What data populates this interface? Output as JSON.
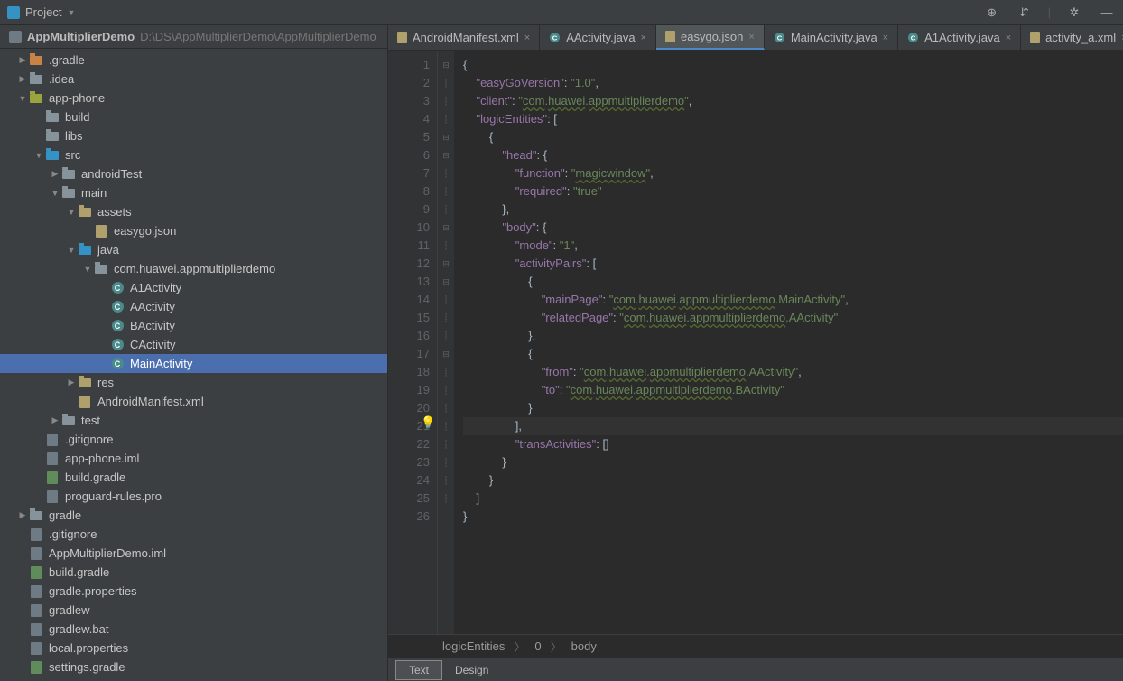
{
  "topbar": {
    "project_label": "Project"
  },
  "toolbar_icons": [
    "target",
    "vsplit",
    "sep",
    "gear",
    "minimize"
  ],
  "breadcrumb": {
    "name": "AppMultiplierDemo",
    "path": "D:\\DS\\AppMultiplierDemo\\AppMultiplierDemo"
  },
  "tree": [
    {
      "depth": 0,
      "arrow": "right",
      "icon": "folder orange",
      "label": ".gradle"
    },
    {
      "depth": 0,
      "arrow": "right",
      "icon": "folder",
      "label": ".idea"
    },
    {
      "depth": 0,
      "arrow": "down",
      "icon": "folder green",
      "label": "app-phone"
    },
    {
      "depth": 1,
      "arrow": "",
      "icon": "folder",
      "label": "build"
    },
    {
      "depth": 1,
      "arrow": "",
      "icon": "folder",
      "label": "libs"
    },
    {
      "depth": 1,
      "arrow": "down",
      "icon": "folder blue",
      "label": "src"
    },
    {
      "depth": 2,
      "arrow": "right",
      "icon": "folder",
      "label": "androidTest"
    },
    {
      "depth": 2,
      "arrow": "down",
      "icon": "folder",
      "label": "main"
    },
    {
      "depth": 3,
      "arrow": "down",
      "icon": "folder yellow",
      "label": "assets"
    },
    {
      "depth": 4,
      "arrow": "",
      "icon": "file json",
      "label": "easygo.json"
    },
    {
      "depth": 3,
      "arrow": "down",
      "icon": "folder blue",
      "label": "java"
    },
    {
      "depth": 4,
      "arrow": "down",
      "icon": "folder",
      "label": "com.huawei.appmultiplierdemo"
    },
    {
      "depth": 5,
      "arrow": "",
      "icon": "class",
      "label": "A1Activity"
    },
    {
      "depth": 5,
      "arrow": "",
      "icon": "class",
      "label": "AActivity"
    },
    {
      "depth": 5,
      "arrow": "",
      "icon": "class",
      "label": "BActivity"
    },
    {
      "depth": 5,
      "arrow": "",
      "icon": "class",
      "label": "CActivity"
    },
    {
      "depth": 5,
      "arrow": "",
      "icon": "class",
      "label": "MainActivity",
      "sel": true
    },
    {
      "depth": 3,
      "arrow": "right",
      "icon": "folder yellow",
      "label": "res"
    },
    {
      "depth": 3,
      "arrow": "",
      "icon": "file xml",
      "label": "AndroidManifest.xml"
    },
    {
      "depth": 2,
      "arrow": "right",
      "icon": "folder",
      "label": "test"
    },
    {
      "depth": 1,
      "arrow": "",
      "icon": "file",
      "label": ".gitignore"
    },
    {
      "depth": 1,
      "arrow": "",
      "icon": "file",
      "label": "app-phone.iml"
    },
    {
      "depth": 1,
      "arrow": "",
      "icon": "file gr",
      "label": "build.gradle"
    },
    {
      "depth": 1,
      "arrow": "",
      "icon": "file",
      "label": "proguard-rules.pro"
    },
    {
      "depth": 0,
      "arrow": "right",
      "icon": "folder",
      "label": "gradle"
    },
    {
      "depth": 0,
      "arrow": "",
      "icon": "file",
      "label": ".gitignore"
    },
    {
      "depth": 0,
      "arrow": "",
      "icon": "file",
      "label": "AppMultiplierDemo.iml"
    },
    {
      "depth": 0,
      "arrow": "",
      "icon": "file gr",
      "label": "build.gradle"
    },
    {
      "depth": 0,
      "arrow": "",
      "icon": "file",
      "label": "gradle.properties"
    },
    {
      "depth": 0,
      "arrow": "",
      "icon": "file",
      "label": "gradlew"
    },
    {
      "depth": 0,
      "arrow": "",
      "icon": "file",
      "label": "gradlew.bat"
    },
    {
      "depth": 0,
      "arrow": "",
      "icon": "file",
      "label": "local.properties"
    },
    {
      "depth": 0,
      "arrow": "",
      "icon": "file gr",
      "label": "settings.gradle"
    }
  ],
  "tabs": [
    {
      "icon": "xml",
      "label": "AndroidManifest.xml"
    },
    {
      "icon": "class",
      "label": "AActivity.java"
    },
    {
      "icon": "json",
      "label": "easygo.json",
      "active": true
    },
    {
      "icon": "class",
      "label": "MainActivity.java"
    },
    {
      "icon": "class",
      "label": "A1Activity.java"
    },
    {
      "icon": "xml",
      "label": "activity_a.xml"
    }
  ],
  "code": {
    "lines": 26,
    "content": "editor json source",
    "keys": {
      "easyGoVersion": "\"easyGoVersion\"",
      "v1": "\"1.0\"",
      "client": "\"client\"",
      "clientv": "\"com.huawei.appmultiplierdemo\"",
      "logicEntities": "\"logicEntities\"",
      "head": "\"head\"",
      "function": "\"function\"",
      "magicwindow": "\"magicwindow\"",
      "required": "\"required\"",
      "true": "\"true\"",
      "body": "\"body\"",
      "mode": "\"mode\"",
      "mode1": "\"1\"",
      "activityPairs": "\"activityPairs\"",
      "mainPage": "\"mainPage\"",
      "mainPageV": "\"com.huawei.appmultiplierdemo.MainActivity\"",
      "relatedPage": "\"relatedPage\"",
      "relatedPageV": "\"com.huawei.appmultiplierdemo.AActivity\"",
      "from": "\"from\"",
      "fromV": "\"com.huawei.appmultiplierdemo.AActivity\"",
      "to": "\"to\"",
      "toV": "\"com.huawei.appmultiplierdemo.BActivity\"",
      "transActivities": "\"transActivities\""
    }
  },
  "crumb2": [
    "logicEntities",
    "0",
    "body"
  ],
  "bottom": {
    "text": "Text",
    "design": "Design"
  }
}
